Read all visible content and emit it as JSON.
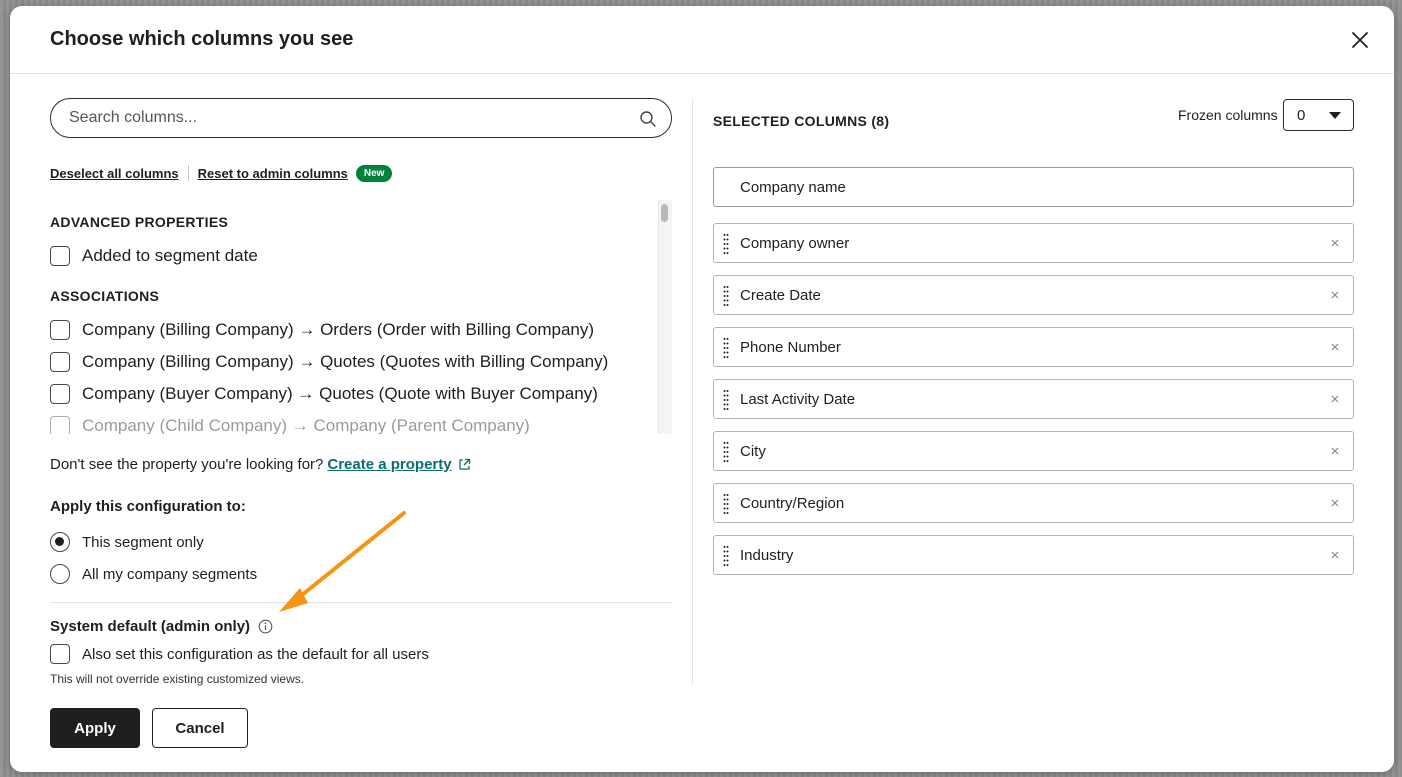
{
  "modal": {
    "title": "Choose which columns you see"
  },
  "search": {
    "placeholder": "Search columns..."
  },
  "links": {
    "deselect_all": "Deselect all columns",
    "reset_admin": "Reset to admin columns",
    "new_badge": "New"
  },
  "property_list": {
    "sections": [
      {
        "heading": "ADVANCED PROPERTIES",
        "items": [
          {
            "label": "Added to segment date",
            "checked": false
          }
        ]
      },
      {
        "heading": "ASSOCIATIONS",
        "items": [
          {
            "label": "Company (Billing Company) → Orders (Order with Billing Company)",
            "checked": false
          },
          {
            "label": "Company (Billing Company) → Quotes (Quotes with Billing Company)",
            "checked": false
          },
          {
            "label": "Company (Buyer Company) → Quotes (Quote with Buyer Company)",
            "checked": false
          },
          {
            "label": "Company (Child Company) → Company (Parent Company)",
            "checked": false
          }
        ]
      }
    ]
  },
  "hint": {
    "text": "Don't see the property you're looking for?",
    "link": "Create a property"
  },
  "apply_config": {
    "heading": "Apply this configuration to:",
    "options": [
      {
        "label": "This segment only",
        "selected": true
      },
      {
        "label": "All my company segments",
        "selected": false
      }
    ]
  },
  "system_default": {
    "heading": "System default (admin only)",
    "checkbox_label": "Also set this configuration as the default for all users",
    "checked": false,
    "note": "This will not override existing customized views."
  },
  "buttons": {
    "apply": "Apply",
    "cancel": "Cancel"
  },
  "selected_columns": {
    "heading": "SELECTED COLUMNS (8)",
    "frozen_label": "Frozen columns",
    "frozen_value": "0",
    "items": [
      {
        "label": "Company name",
        "removable": false
      },
      {
        "label": "Company owner",
        "removable": true
      },
      {
        "label": "Create Date",
        "removable": true
      },
      {
        "label": "Phone Number",
        "removable": true
      },
      {
        "label": "Last Activity Date",
        "removable": true
      },
      {
        "label": "City",
        "removable": true
      },
      {
        "label": "Country/Region",
        "removable": true
      },
      {
        "label": "Industry",
        "removable": true
      }
    ]
  },
  "colors": {
    "primary_button": "#1f1f1f",
    "new_badge": "#00823a",
    "link_teal": "#0a6e6e",
    "annotation_arrow": "#f5940f"
  },
  "icons": {
    "close": "close-icon",
    "search": "search-icon",
    "external_link": "external-link-icon",
    "info": "info-icon",
    "drag": "drag-handle-icon",
    "remove": "remove-icon",
    "annotation": "annotation-arrow"
  }
}
